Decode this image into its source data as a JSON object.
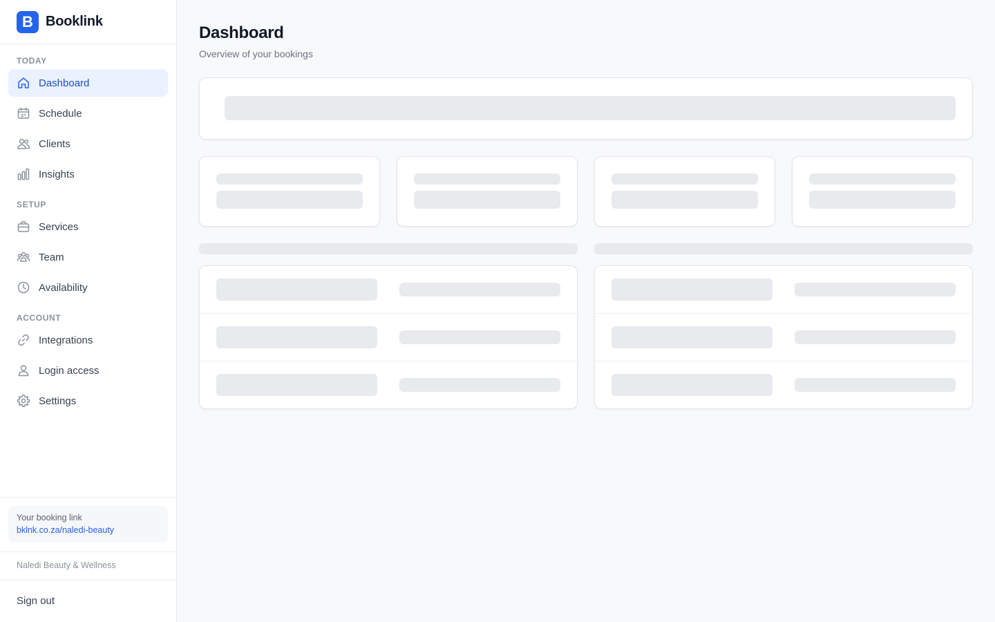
{
  "app": {
    "name": "Booklink",
    "logo_letter": "B"
  },
  "sidebar": {
    "sections": [
      {
        "label": "TODAY",
        "items": [
          {
            "label": "Dashboard",
            "icon": "home-icon",
            "active": true
          },
          {
            "label": "Schedule",
            "icon": "calendar-icon"
          },
          {
            "label": "Clients",
            "icon": "users-icon"
          },
          {
            "label": "Insights",
            "icon": "bar-chart-icon"
          }
        ]
      },
      {
        "label": "SETUP",
        "items": [
          {
            "label": "Services",
            "icon": "briefcase-icon"
          },
          {
            "label": "Team",
            "icon": "team-icon"
          },
          {
            "label": "Availability",
            "icon": "clock-icon"
          }
        ]
      },
      {
        "label": "ACCOUNT",
        "items": [
          {
            "label": "Integrations",
            "icon": "link-icon"
          },
          {
            "label": "Login access",
            "icon": "user-icon"
          },
          {
            "label": "Settings",
            "icon": "gear-icon"
          }
        ]
      }
    ],
    "booking_card": {
      "caption": "Your booking link",
      "link": "bklnk.co.za/naledi-beauty"
    },
    "business_name": "Naledi Beauty & Wellness",
    "sign_out": "Sign out"
  },
  "main": {
    "title": "Dashboard",
    "subtitle": "Overview of your bookings",
    "loading": true
  },
  "colors": {
    "accent": "#2563eb",
    "active_bg": "#eaf2ff",
    "skeleton": "#e9eaee"
  }
}
